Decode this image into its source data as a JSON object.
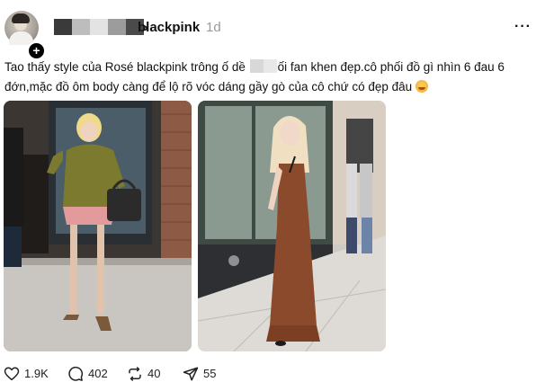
{
  "post": {
    "username": "blackpink",
    "time_ago": "1d",
    "caption_part1": "Tao thấy style của Rosé blackpink trông ố dề",
    "caption_part2": "ối fan khen đẹp.cô phối đồ gì nhìn 6 đau 6 đớn,mặc đồ ôm body càng để lộ rõ vóc dáng gầy gò của cô chứ có đẹp đâu",
    "emoji": "grinning-sweat-emoji",
    "more_menu_icon": "ellipsis-icon",
    "follow_badge": "+"
  },
  "actions": {
    "likes": "1.9K",
    "comments": "402",
    "reposts": "40",
    "shares": "55"
  },
  "icons": {
    "like": "heart-icon",
    "comment": "comment-bubble-icon",
    "repost": "repost-icon",
    "share": "send-icon"
  },
  "colors": {
    "text": "#111111",
    "muted": "#9a9a9a",
    "background": "#ffffff",
    "dress_brown": "#8b4a2b",
    "sweater_olive": "#7b7a2e",
    "skirt_pink": "#e39a9a"
  }
}
